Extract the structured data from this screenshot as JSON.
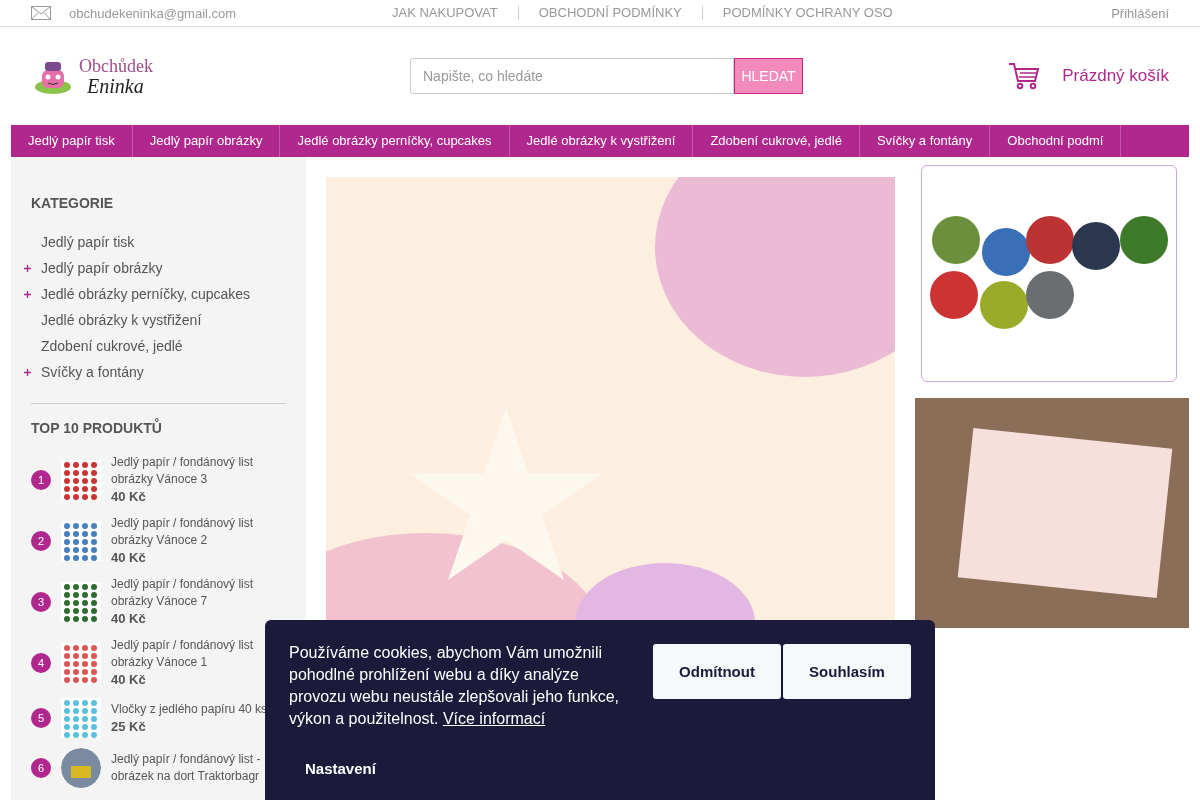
{
  "top_bar": {
    "email": "obchudekeninka@gmail.com",
    "links": [
      "JAK NAKUPOVAT",
      "OBCHODNÍ PODMÍNKY",
      "PODMÍNKY OCHRANY OSO"
    ],
    "login": "Přihlášení"
  },
  "header": {
    "logo": {
      "line_1": "Obchůdek",
      "line_2": "Eninka"
    },
    "search": {
      "placeholder": "Napište, co hledáte",
      "button": "HLEDAT"
    },
    "cart": "Prázdný košík"
  },
  "nav": [
    "Jedlý papír tisk",
    "Jedlý papír obrázky",
    "Jedlé obrázky perníčky, cupcakes",
    "Jedlé obrázky k vystřižení",
    "Zdobení cukrové, jedlé",
    "Svíčky a fontány",
    "Obchodní podmí"
  ],
  "sidebar": {
    "categories_title": "KATEGORIE",
    "categories": [
      {
        "label": "Jedlý papír tisk",
        "expandable": false
      },
      {
        "label": "Jedlý papír obrázky",
        "expandable": true
      },
      {
        "label": "Jedlé obrázky perníčky, cupcakes",
        "expandable": true
      },
      {
        "label": "Jedlé obrázky k vystřižení",
        "expandable": false
      },
      {
        "label": "Zdobení cukrové, jedlé",
        "expandable": false
      },
      {
        "label": "Svíčky a fontány",
        "expandable": true
      }
    ],
    "top_title": "TOP 10 PRODUKTŮ",
    "products": [
      {
        "rank": "1",
        "name": "Jedlý papír / fondánový list obrázky Vánoce 3",
        "price": "40 Kč"
      },
      {
        "rank": "2",
        "name": "Jedlý papír / fondánový list obrázky Vánoce 2",
        "price": "40 Kč"
      },
      {
        "rank": "3",
        "name": "Jedlý papír / fondánový list obrázky Vánoce 7",
        "price": "40 Kč"
      },
      {
        "rank": "4",
        "name": "Jedlý papír / fondánový list obrázky Vánoce 1",
        "price": "40 Kč"
      },
      {
        "rank": "5",
        "name": "Vločky z jedlého papíru 40 ks",
        "price": "25 Kč"
      },
      {
        "rank": "6",
        "name": "Jedlý papír / fondánový list - obrázek na dort Traktorbagr"
      }
    ]
  },
  "cookie_bar": {
    "text": "Používáme cookies, abychom Vám umožnili pohodlné prohlížení webu a díky analýze provozu webu neustále zlepšovali jeho funkce, výkon a použitelnost.",
    "link": "Více informací",
    "buttons": [
      "Odmítnout",
      "Souhlasím"
    ],
    "settings": "Nastavení"
  }
}
